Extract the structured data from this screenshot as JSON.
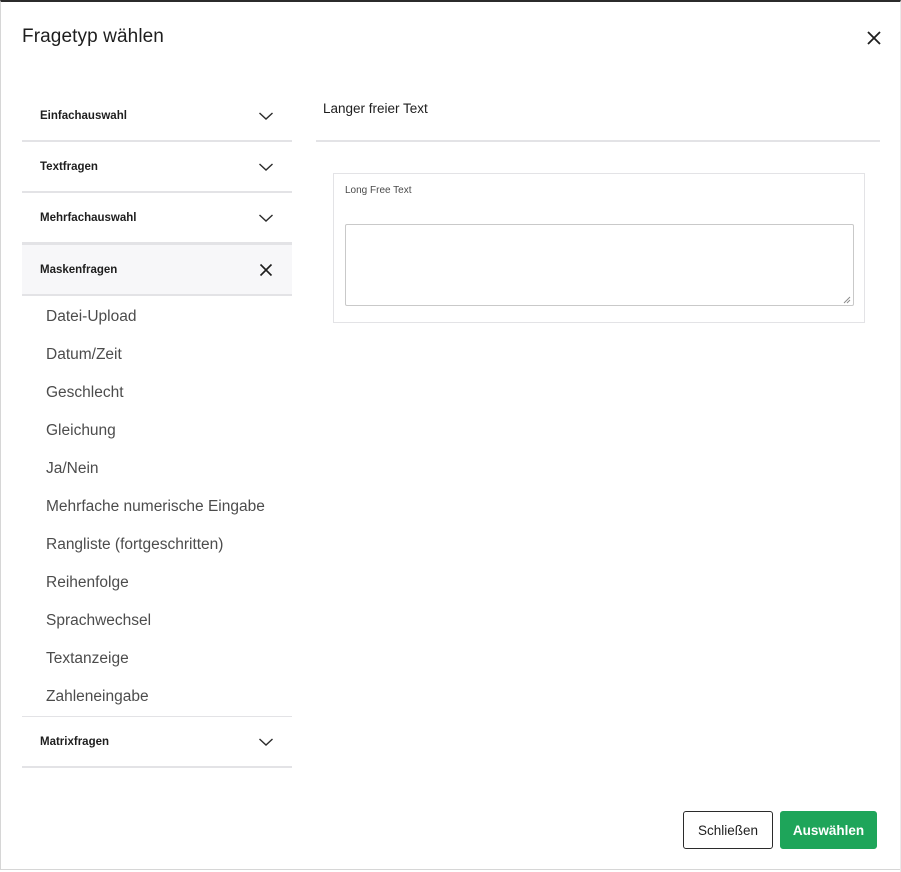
{
  "dialog": {
    "title": "Fragetyp wählen",
    "close_icon": "close-icon"
  },
  "accordion": {
    "groups": [
      {
        "label": "Einfachauswahl",
        "state": "collapsed",
        "icon": "chevron-down-icon"
      },
      {
        "label": "Textfragen",
        "state": "collapsed",
        "icon": "chevron-down-icon"
      },
      {
        "label": "Mehrfachauswahl",
        "state": "collapsed",
        "icon": "chevron-down-icon"
      },
      {
        "label": "Maskenfragen",
        "state": "expanded",
        "icon": "close-icon",
        "items": [
          "Datei-Upload",
          "Datum/Zeit",
          "Geschlecht",
          "Gleichung",
          "Ja/Nein",
          "Mehrfache numerische Eingabe",
          "Rangliste (fortgeschritten)",
          "Reihenfolge",
          "Sprachwechsel",
          "Textanzeige",
          "Zahleneingabe"
        ]
      },
      {
        "label": "Matrixfragen",
        "state": "collapsed",
        "icon": "chevron-down-icon"
      }
    ]
  },
  "preview": {
    "title": "Langer freier Text",
    "card_label": "Long Free Text",
    "textarea_value": ""
  },
  "footer": {
    "close_label": "Schließen",
    "select_label": "Auswählen"
  },
  "colors": {
    "accent": "#1ea55a",
    "divider": "#e3e3e6",
    "text": "#1e1e1e"
  }
}
